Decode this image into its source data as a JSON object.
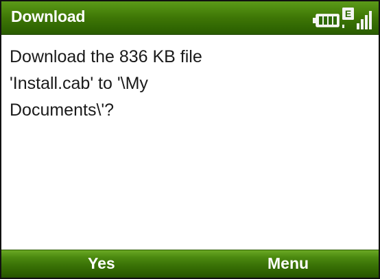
{
  "title_bar": {
    "title": "Download",
    "status_icons": [
      "battery-icon",
      "network-edge-icon",
      "signal-strength-icon"
    ],
    "network_type": "E"
  },
  "dialog": {
    "message_lines": [
      "Download the 836 KB file",
      "'Install.cab' to '\\My",
      "Documents\\'?"
    ]
  },
  "softkeys": {
    "left": "Yes",
    "right": "Menu"
  },
  "colors": {
    "bar_green": "#3e7606",
    "text": "#1a1a1a",
    "background": "#ffffff"
  }
}
